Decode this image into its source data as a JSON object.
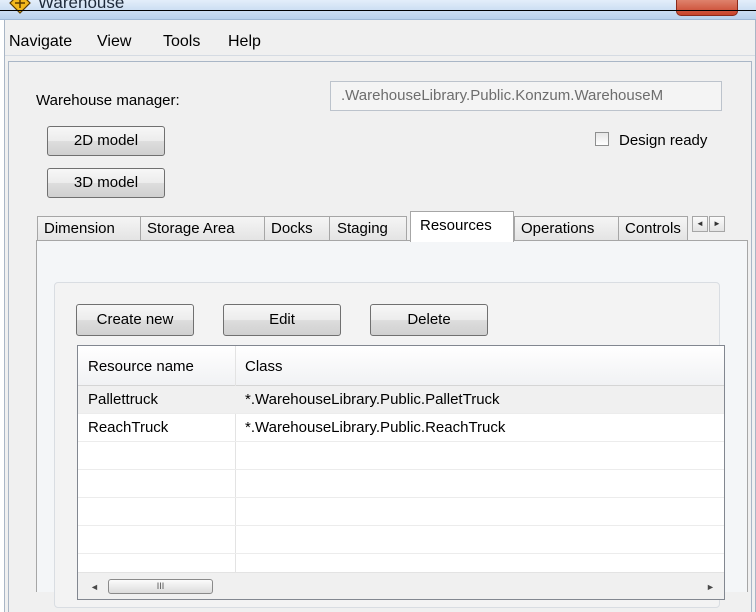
{
  "window": {
    "title": "Warehouse"
  },
  "menu": [
    "Navigate",
    "View",
    "Tools",
    "Help"
  ],
  "form": {
    "manager_label": "Warehouse manager:",
    "manager_value": ".WarehouseLibrary.Public.Konzum.WarehouseM",
    "btn_2d": "2D model",
    "btn_3d": "3D model",
    "design_ready_label": "Design ready",
    "design_ready_checked": false
  },
  "tabs": [
    "Dimension",
    "Storage Area",
    "Docks",
    "Staging",
    "Resources",
    "Operations",
    "Controls"
  ],
  "active_tab": "Resources",
  "toolbar": {
    "create": "Create new",
    "edit": "Edit",
    "delete": "Delete"
  },
  "grid": {
    "columns": [
      "Resource name",
      "Class"
    ],
    "rows": [
      {
        "name": "Pallettruck",
        "class": "*.WarehouseLibrary.Public.PalletTruck",
        "selected": true
      },
      {
        "name": "ReachTruck",
        "class": "*.WarehouseLibrary.Public.ReachTruck",
        "selected": false
      }
    ]
  },
  "scroll": {
    "left": "◄",
    "right": "►",
    "thumb": "III"
  },
  "colors": {
    "close_button": "#c8432a",
    "title_bar": "#b9d1ec"
  }
}
